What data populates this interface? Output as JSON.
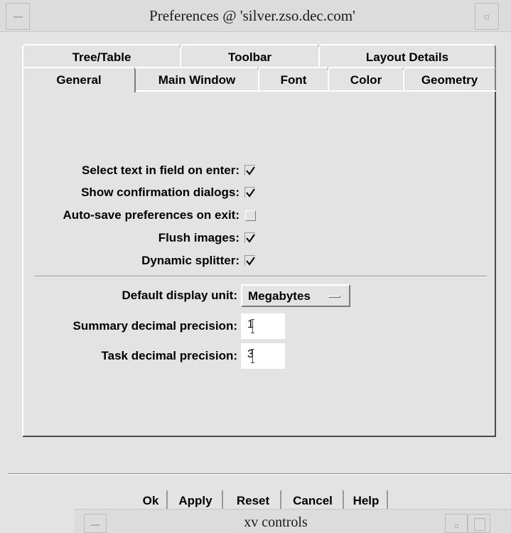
{
  "window": {
    "title": "Preferences @ 'silver.zso.dec.com'"
  },
  "tabs": {
    "row1": [
      "Tree/Table",
      "Toolbar",
      "Layout Details"
    ],
    "row2": [
      "General",
      "Main Window",
      "Font",
      "Color",
      "Geometry"
    ],
    "active": "General"
  },
  "general": {
    "checkboxes": [
      {
        "label": "Select text in field on enter:",
        "checked": true
      },
      {
        "label": "Show confirmation dialogs:",
        "checked": true
      },
      {
        "label": "Auto-save preferences on exit:",
        "checked": false
      },
      {
        "label": "Flush images:",
        "checked": true
      },
      {
        "label": "Dynamic splitter:",
        "checked": true
      }
    ],
    "display_unit": {
      "label": "Default display unit:",
      "value": "Megabytes"
    },
    "summary_precision": {
      "label": "Summary decimal precision:",
      "value": "1"
    },
    "task_precision": {
      "label": "Task decimal precision:",
      "value": "3"
    }
  },
  "buttons": {
    "ok": "Ok",
    "apply": "Apply",
    "reset": "Reset",
    "cancel": "Cancel",
    "help": "Help"
  },
  "xv_window": {
    "title": "xv controls"
  }
}
